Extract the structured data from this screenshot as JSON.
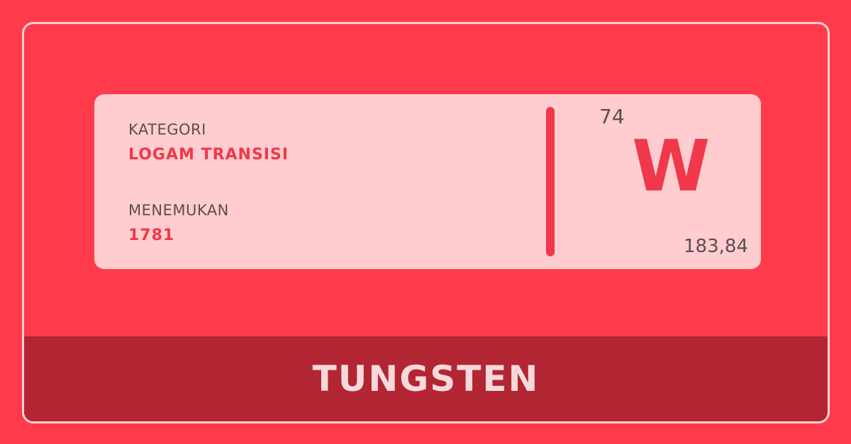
{
  "element": {
    "category_label": "KATEGORI",
    "category_value": "LOGAM TRANSISI",
    "discovered_label": "MENEMUKAN",
    "discovered_value": "1781",
    "atomic_number": "74",
    "symbol": "W",
    "atomic_mass": "183,84",
    "name": "TUNGSTEN"
  },
  "colors": {
    "background": "#ff3b4b",
    "card": "#ffcdd0",
    "accent": "#f0384a",
    "name_bar": "#b12632",
    "text_dark": "#5a4e50",
    "frame_border": "#fbd0d3"
  }
}
